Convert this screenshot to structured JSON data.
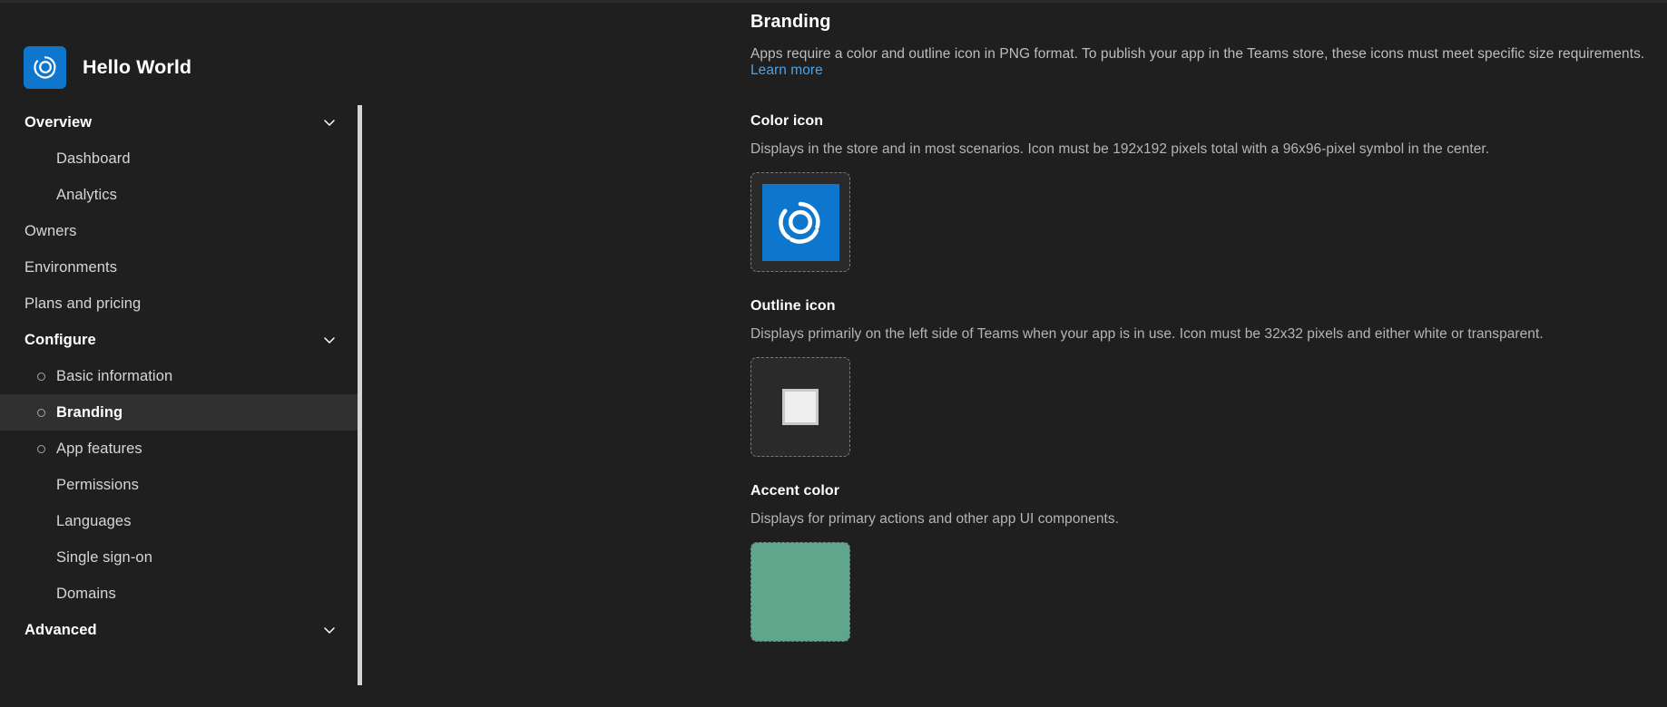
{
  "app": {
    "name": "Hello World",
    "logo_icon": "spiral-swirl-icon",
    "logo_bg_color": "#0f76cd"
  },
  "sidebar": {
    "groups": [
      {
        "label": "Overview",
        "chevron_icon": "chevron-down-icon",
        "items": [
          {
            "label": "Dashboard",
            "bullet": false,
            "selected": false
          },
          {
            "label": "Analytics",
            "bullet": false,
            "selected": false
          }
        ]
      }
    ],
    "top_items": [
      {
        "label": "Owners",
        "bullet": false,
        "selected": false
      },
      {
        "label": "Environments",
        "bullet": false,
        "selected": false
      },
      {
        "label": "Plans and pricing",
        "bullet": false,
        "selected": false
      }
    ],
    "configure": {
      "label": "Configure",
      "chevron_icon": "chevron-down-icon",
      "items": [
        {
          "label": "Basic information",
          "bullet": true,
          "selected": false
        },
        {
          "label": "Branding",
          "bullet": true,
          "selected": true
        },
        {
          "label": "App features",
          "bullet": true,
          "selected": false
        },
        {
          "label": "Permissions",
          "bullet": false,
          "selected": false
        },
        {
          "label": "Languages",
          "bullet": false,
          "selected": false
        },
        {
          "label": "Single sign-on",
          "bullet": false,
          "selected": false
        },
        {
          "label": "Domains",
          "bullet": false,
          "selected": false
        }
      ]
    },
    "advanced": {
      "label": "Advanced",
      "chevron_icon": "chevron-down-icon"
    }
  },
  "main": {
    "title": "Branding",
    "description_before_link": "Apps require a color and outline icon in PNG format. To publish your app in the Teams store, these icons must meet specific size requirements. ",
    "learn_more_label": "Learn more",
    "sections": [
      {
        "title": "Color icon",
        "description": "Displays in the store and in most scenarios. Icon must be 192x192 pixels total with a 96x96-pixel symbol in the center.",
        "preview_type": "color-icon",
        "preview_bg": "#0f76cd"
      },
      {
        "title": "Outline icon",
        "description": "Displays primarily on the left side of Teams when your app is in use. Icon must be 32x32 pixels and either white or transparent.",
        "preview_type": "outline-icon",
        "preview_bg": "#efefef"
      },
      {
        "title": "Accent color",
        "description": "Displays for primary actions and other app UI components.",
        "preview_type": "accent-swatch",
        "preview_bg": "#5fa68c"
      }
    ]
  }
}
